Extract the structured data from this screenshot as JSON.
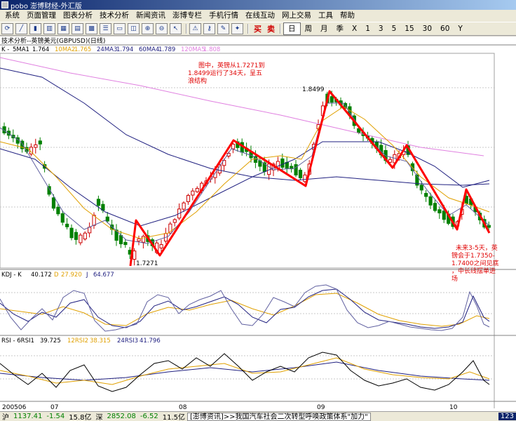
{
  "app": {
    "title": "pobo 澎博财经-外汇版"
  },
  "menu": [
    "系统",
    "页面管理",
    "图表分析",
    "技术分析",
    "新闻资讯",
    "澎博专栏",
    "手机行情",
    "在线互动",
    "网上交易",
    "工具",
    "帮助"
  ],
  "toolbar": {
    "buy_label": "买",
    "sell_label": "卖",
    "periods": [
      "日",
      "周",
      "月",
      "季",
      "X",
      "1",
      "3",
      "5",
      "15",
      "30",
      "60",
      "Y"
    ],
    "active_period": "日"
  },
  "chart": {
    "panel_title": "技术分析--英镑美元(GBPUSD)(日线)",
    "ma_legend": {
      "prefix": "K - ",
      "items": [
        {
          "label": "5MA1",
          "value": "1.764",
          "color": "#000000"
        },
        {
          "label": "10MA2",
          "value": "1.765",
          "color": "#e0a000"
        },
        {
          "label": "24MA3",
          "value": "1.794",
          "color": "#202080"
        },
        {
          "label": "60MA4",
          "value": "1.789",
          "color": "#202080"
        },
        {
          "label": "120MA5",
          "value": "1.808",
          "color": "#e080e0"
        }
      ]
    },
    "annotations": {
      "top_note": [
        "图中，英镑从1.7271到",
        "1.8499运行了34天，呈五",
        "浪结构"
      ],
      "high_label": "1.8499",
      "low_label": "1.7271",
      "future_note": [
        "未来3-5天，英",
        "镑会于1.7350-",
        "1.7400之间见底",
        "，中长线摆单进",
        "场"
      ]
    },
    "kdj": {
      "label": "KDJ - K",
      "k": "40.172",
      "d_label": "D",
      "d": "27.920",
      "j_label": "J",
      "j": "64.677"
    },
    "rsi": {
      "label": "RSI - 6RSI1",
      "r1": "39.725",
      "r2_label": "12RSI2",
      "r2": "38.315",
      "r3_label": "24RSI3",
      "r3": "41.796"
    },
    "x_ticks": [
      "200506",
      "07",
      "08",
      "09",
      "10"
    ]
  },
  "status": {
    "sh_label": "沪",
    "sh_index": "1137.41",
    "sh_change": "-1.54",
    "sh_volume": "15.8亿",
    "sz_label": "深",
    "sz_index": "2852.08",
    "sz_change": "-6.52",
    "sz_volume": "11.5亿",
    "news": "[澎博资讯]>>我国汽车社会二次转型呼唤政策体系\"加力\"",
    "badge": "123"
  },
  "colors": {
    "up": "#cc0000",
    "down": "#008000",
    "wave": "#ff0000"
  }
}
